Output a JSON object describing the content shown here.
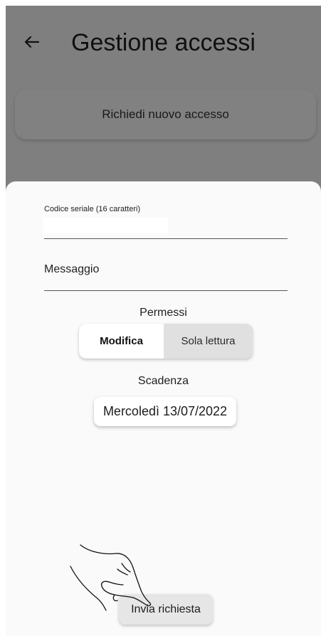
{
  "header": {
    "title": "Gestione accessi",
    "back_icon": "arrow-left-icon"
  },
  "background_card": {
    "label": "Richiedi nuovo accesso"
  },
  "form": {
    "serial_label": "Codice seriale (16 caratteri)",
    "serial_value": "",
    "message_placeholder": "Messaggio",
    "message_value": "",
    "permissions": {
      "label": "Permessi",
      "options": [
        "Modifica",
        "Sola lettura"
      ],
      "selected": "Modifica"
    },
    "expiry": {
      "label": "Scadenza",
      "date": "Mercoledì 13/07/2022"
    },
    "submit_label": "Invia richiesta"
  },
  "overlay_icon": "hand-pointer-icon",
  "colors": {
    "scrim": "#000000",
    "sheet": "#fafafa",
    "selected_toggle": "#ffffff",
    "unselected_toggle": "#e0e0e0"
  }
}
